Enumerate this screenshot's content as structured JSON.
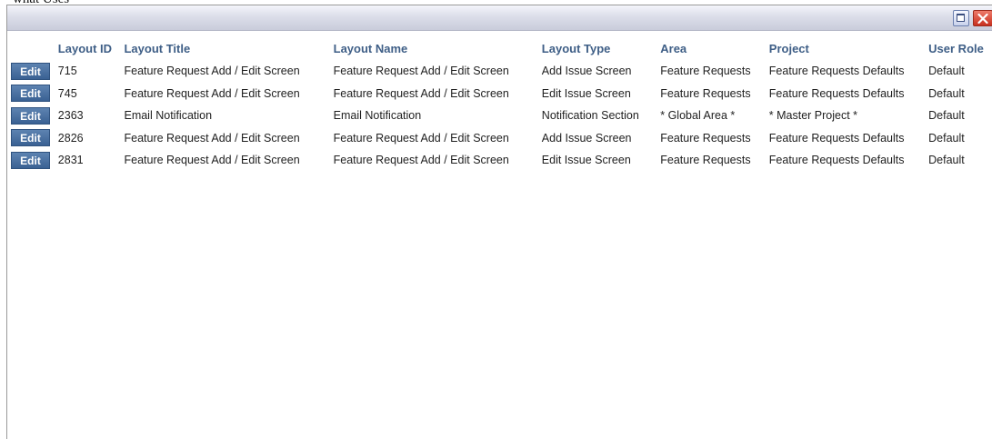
{
  "caption": "what Uses",
  "window": {
    "maximize_icon": "maximize-icon",
    "close_icon": "close-icon"
  },
  "columns": {
    "layout_id": "Layout ID",
    "layout_title": "Layout Title",
    "layout_name": "Layout Name",
    "layout_type": "Layout Type",
    "area": "Area",
    "project": "Project",
    "user_role": "User Role"
  },
  "edit_label": "Edit",
  "rows": [
    {
      "id": "715",
      "title": "Feature Request Add / Edit Screen",
      "name": "Feature Request Add / Edit Screen",
      "type": "Add Issue Screen",
      "area": "Feature Requests",
      "project": "Feature Requests Defaults",
      "role": "Default"
    },
    {
      "id": "745",
      "title": "Feature Request Add / Edit Screen",
      "name": "Feature Request Add / Edit Screen",
      "type": "Edit Issue Screen",
      "area": "Feature Requests",
      "project": "Feature Requests Defaults",
      "role": "Default"
    },
    {
      "id": "2363",
      "title": "Email Notification",
      "name": "Email Notification",
      "type": "Notification Section",
      "area": "* Global Area *",
      "project": "* Master Project *",
      "role": "Default"
    },
    {
      "id": "2826",
      "title": "Feature Request Add / Edit Screen",
      "name": "Feature Request Add / Edit Screen",
      "type": "Add Issue Screen",
      "area": "Feature Requests",
      "project": "Feature Requests Defaults",
      "role": "Default"
    },
    {
      "id": "2831",
      "title": "Feature Request Add / Edit Screen",
      "name": "Feature Request Add / Edit Screen",
      "type": "Edit Issue Screen",
      "area": "Feature Requests",
      "project": "Feature Requests Defaults",
      "role": "Default"
    }
  ]
}
